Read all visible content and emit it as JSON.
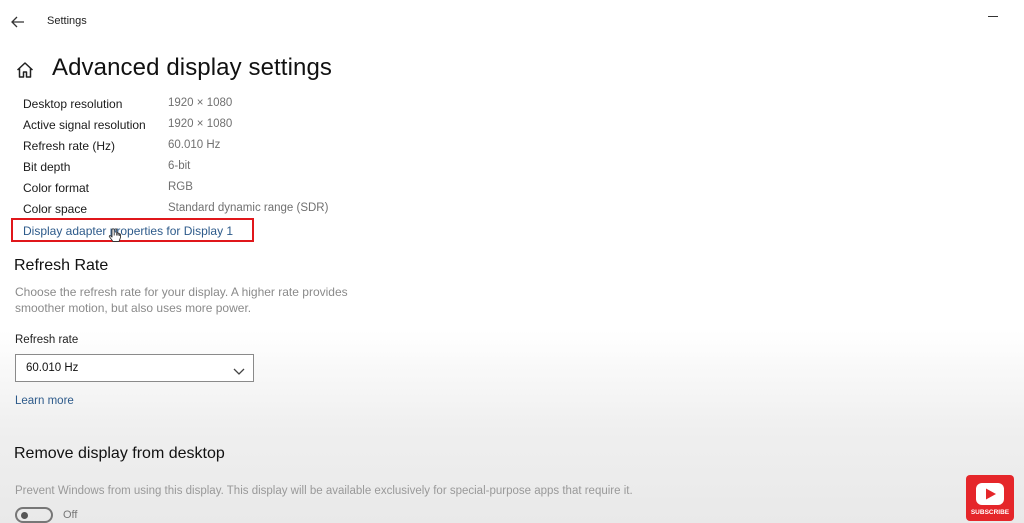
{
  "window": {
    "title": "Settings"
  },
  "page": {
    "title": "Advanced display settings"
  },
  "display_info": [
    {
      "label": "Desktop resolution",
      "value": "1920 × 1080"
    },
    {
      "label": "Active signal resolution",
      "value": "1920 × 1080"
    },
    {
      "label": "Refresh rate (Hz)",
      "value": "60.010 Hz"
    },
    {
      "label": "Bit depth",
      "value": "6-bit"
    },
    {
      "label": "Color format",
      "value": "RGB"
    },
    {
      "label": "Color space",
      "value": "Standard dynamic range (SDR)"
    }
  ],
  "adapter_link": "Display adapter properties for Display 1",
  "refresh_section": {
    "title": "Refresh Rate",
    "desc_line1": "Choose the refresh rate for your display. A higher rate provides",
    "desc_line2": "smoother motion, but also uses more power.",
    "field_label": "Refresh rate",
    "selected": "60.010 Hz",
    "learn_more": "Learn more"
  },
  "remove_section": {
    "title": "Remove display from desktop",
    "desc": "Prevent Windows from using this display. This display will be available exclusively for special-purpose apps that require it.",
    "toggle_state": "Off"
  },
  "subscribe_badge": {
    "label": "SUBSCRIBE"
  },
  "icons": [
    "back-arrow-icon",
    "home-icon",
    "chevron-down-icon",
    "pointer-hand-icon",
    "play-icon"
  ],
  "colors": {
    "link": "#2d5a8a",
    "highlight": "#e0171b",
    "badge": "#e5262a"
  }
}
